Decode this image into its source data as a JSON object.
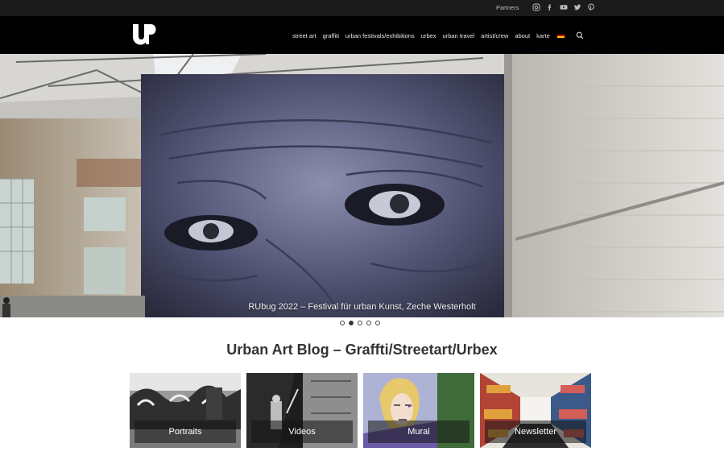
{
  "topbar": {
    "partners_label": "Partners",
    "social_icons": [
      "instagram-icon",
      "facebook-icon",
      "youtube-icon",
      "twitter-icon",
      "pinterest-icon"
    ]
  },
  "navbar": {
    "logo": "UP",
    "items": [
      "street art",
      "graffiti",
      "urban festivals/exhibitions",
      "urbex",
      "urban travel",
      "artist/crew",
      "about",
      "karte"
    ],
    "language_icon": "german-flag-icon",
    "search_icon": "search-icon"
  },
  "hero": {
    "caption": "RUbug 2022 – Festival für urban Kunst, Zeche Westerholt",
    "slide_count": 5,
    "active_slide": 2
  },
  "main": {
    "title": "Urban Art Blog – Graffti/Streetart/Urbex",
    "tiles": [
      {
        "label": "Portraits"
      },
      {
        "label": "Videos"
      },
      {
        "label": "Mural"
      },
      {
        "label": "Newsletter"
      }
    ]
  },
  "colors": {
    "topbar": "#1b1b1b",
    "navbar": "#000000",
    "text": "#333333"
  }
}
